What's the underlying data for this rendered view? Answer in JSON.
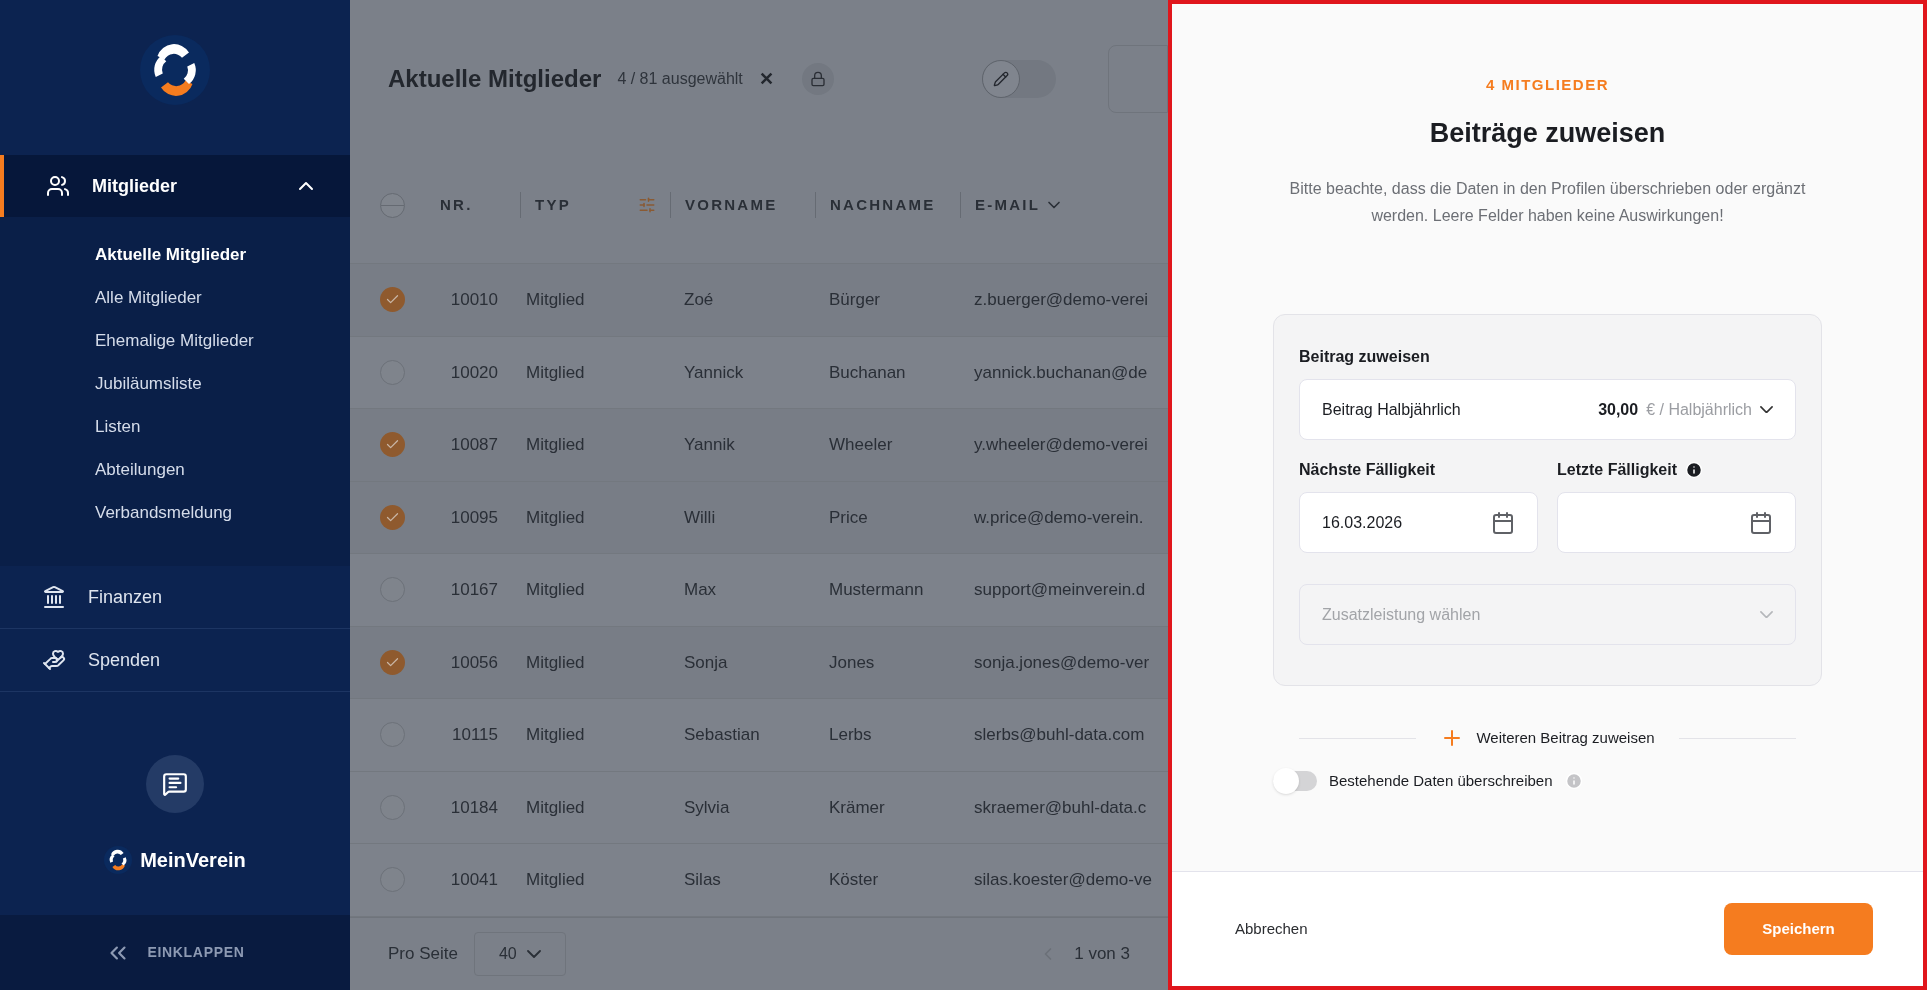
{
  "sidebar": {
    "brand": "MeinVerein",
    "collapse": "EINKLAPPEN",
    "sections": [
      {
        "label": "Mitglieder",
        "expanded": true,
        "selected": true,
        "children": [
          {
            "label": "Aktuelle Mitglieder",
            "selected": true
          },
          {
            "label": "Alle Mitglieder",
            "selected": false
          },
          {
            "label": "Ehemalige Mitglieder",
            "selected": false
          },
          {
            "label": "Jubiläumsliste",
            "selected": false
          },
          {
            "label": "Listen",
            "selected": false
          },
          {
            "label": "Abteilungen",
            "selected": false
          },
          {
            "label": "Verbandsmeldung",
            "selected": false
          }
        ]
      },
      {
        "label": "Finanzen",
        "expanded": false,
        "selected": false
      },
      {
        "label": "Spenden",
        "expanded": false,
        "selected": false
      }
    ]
  },
  "list": {
    "title": "Aktuelle Mitglieder",
    "selection": "4 / 81 ausgewählt",
    "clear": "✕",
    "edit_mode": {
      "on": false
    },
    "select_all": {
      "checked": false
    },
    "columns": [
      "NR.",
      "TYP",
      "VORNAME",
      "NACHNAME",
      "E-MAIL"
    ],
    "rows": [
      {
        "selected": true,
        "cells": [
          "10010",
          "Mitglied",
          "Zoé",
          "Bürger",
          "z.buerger@demo-verei"
        ]
      },
      {
        "selected": false,
        "cells": [
          "10020",
          "Mitglied",
          "Yannick",
          "Buchanan",
          "yannick.buchanan@de"
        ]
      },
      {
        "selected": true,
        "cells": [
          "10087",
          "Mitglied",
          "Yannik",
          "Wheeler",
          "y.wheeler@demo-verei"
        ]
      },
      {
        "selected": true,
        "cells": [
          "10095",
          "Mitglied",
          "Willi",
          "Price",
          "w.price@demo-verein."
        ]
      },
      {
        "selected": false,
        "cells": [
          "10167",
          "Mitglied",
          "Max",
          "Mustermann",
          "support@meinverein.d"
        ]
      },
      {
        "selected": true,
        "cells": [
          "10056",
          "Mitglied",
          "Sonja",
          "Jones",
          "sonja.jones@demo-ver"
        ]
      },
      {
        "selected": false,
        "cells": [
          "10115",
          "Mitglied",
          "Sebastian",
          "Lerbs",
          "slerbs@buhl-data.com"
        ]
      },
      {
        "selected": false,
        "cells": [
          "10184",
          "Mitglied",
          "Sylvia",
          "Krämer",
          "skraemer@buhl-data.c"
        ]
      },
      {
        "selected": false,
        "cells": [
          "10041",
          "Mitglied",
          "Silas",
          "Köster",
          "silas.koester@demo-ve"
        ]
      }
    ],
    "per_page_label": "Pro Seite",
    "per_page": "40",
    "pagination": "1 von 3"
  },
  "panel": {
    "eyebrow": "4 MITGLIEDER",
    "title": "Beiträge zuweisen",
    "description": "Bitte beachte, dass die Daten in den Profilen überschrieben oder ergänzt werden. Leere Felder haben keine Auswirkungen!",
    "fee_label": "Beitrag zuweisen",
    "fee_name": "Beitrag Halbjährlich",
    "fee_amount": "30,00",
    "fee_unit": "€ / Halbjährlich",
    "next_due_label": "Nächste Fälligkeit",
    "next_due": "16.03.2026",
    "last_due_label": "Letzte Fälligkeit",
    "extra_placeholder": "Zusatzleistung wählen",
    "add_fee": "Weiteren Beitrag zuweisen",
    "overwrite": {
      "label": "Bestehende Daten überschreiben",
      "on": false
    },
    "cancel": "Abbrechen",
    "save": "Speichern"
  }
}
